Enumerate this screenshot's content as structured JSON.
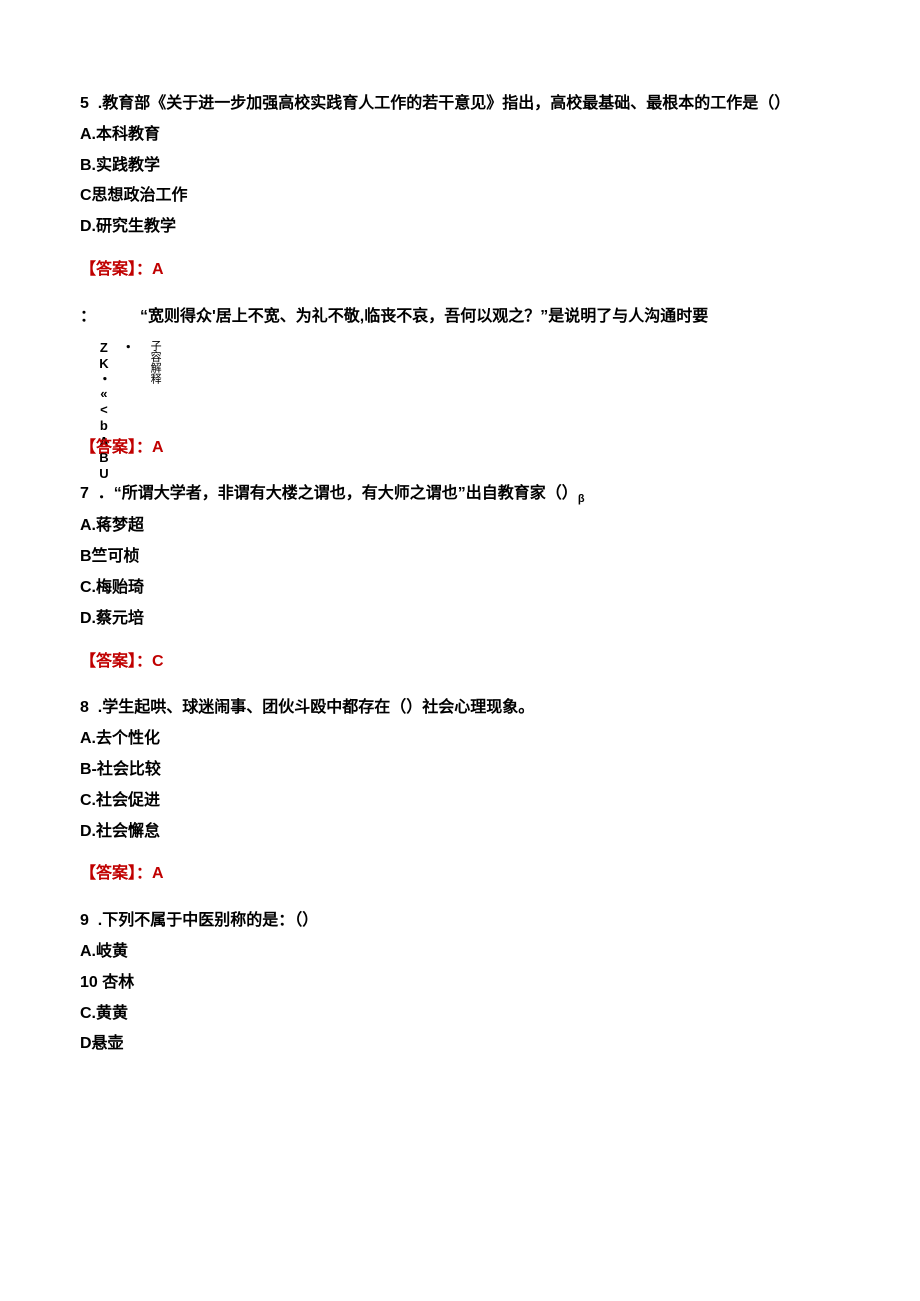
{
  "q5": {
    "num": "5",
    "stem_line1": ".教育部《关于进一步加强高校实践育人工作的若干意见》指出，高校最基础、最根本的工作是（）",
    "optA": "A.本科教育",
    "optB": "B.实践教学",
    "optC": "C思想政治工作",
    "optD": "D.研究生教学",
    "answer": "【答案】：A"
  },
  "q6": {
    "colon_prefix": "：",
    "stem": "“宽则得众'居上不宽、为礼不敬,临丧不哀，吾何以观之？”是说明了与人沟通时要",
    "vert1": "子容解释",
    "vert2": "・ZK・«<bABU",
    "answer": "【答案】：A"
  },
  "q7": {
    "num": "7",
    "stem": "．“所谓大学者，非谓有大楼之谓也，有大师之谓也”出自教育家（）",
    "sub": "β",
    "optA": "A.蒋梦超",
    "optB": "B竺可桢",
    "optC": "C.梅贻琦",
    "optD": "D.蔡元培",
    "answer": "【答案】：C"
  },
  "q8": {
    "num": "8",
    "stem": ".学生起哄、球迷闹事、团伙斗殴中都存在（）社会心理现象。",
    "optA": "A.去个性化",
    "optB": "B-社会比较",
    "optC": "C.社会促进",
    "optD": "D.社会懈怠",
    "answer": "【答案】：A"
  },
  "q9": {
    "num": "9",
    "stem": ".下列不属于中医别称的是：（）",
    "optA": "A.岐黄",
    "optB": "10  杏林",
    "optC": "C.黄黄",
    "optD": "D悬壶"
  }
}
